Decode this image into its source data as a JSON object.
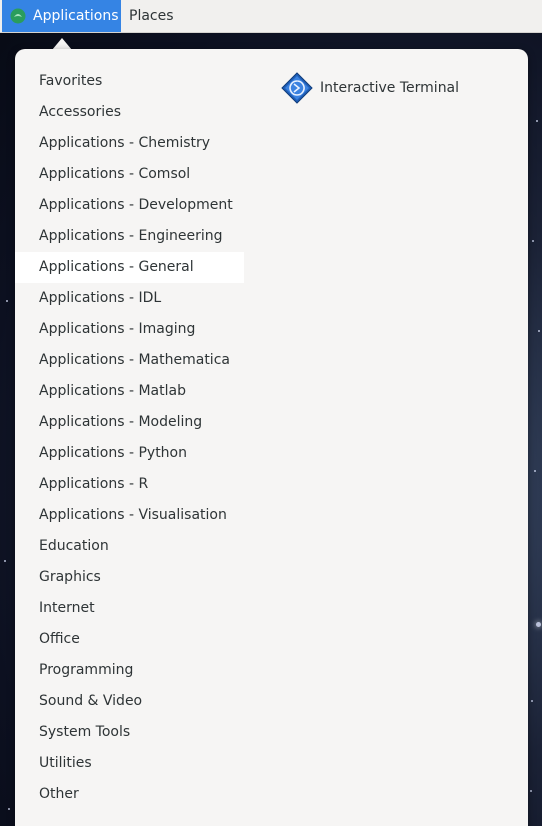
{
  "panel": {
    "applications_label": "Applications",
    "places_label": "Places"
  },
  "categories": [
    {
      "label": "Favorites"
    },
    {
      "label": "Accessories"
    },
    {
      "label": "Applications - Chemistry"
    },
    {
      "label": "Applications - Comsol"
    },
    {
      "label": "Applications - Development"
    },
    {
      "label": "Applications - Engineering"
    },
    {
      "label": "Applications - General",
      "selected": true
    },
    {
      "label": "Applications - IDL"
    },
    {
      "label": "Applications - Imaging"
    },
    {
      "label": "Applications - Mathematica"
    },
    {
      "label": "Applications - Matlab"
    },
    {
      "label": "Applications - Modeling"
    },
    {
      "label": "Applications - Python"
    },
    {
      "label": "Applications - R"
    },
    {
      "label": "Applications - Visualisation"
    },
    {
      "label": "Education"
    },
    {
      "label": "Graphics"
    },
    {
      "label": "Internet"
    },
    {
      "label": "Office"
    },
    {
      "label": "Programming"
    },
    {
      "label": "Sound & Video"
    },
    {
      "label": "System Tools"
    },
    {
      "label": "Utilities"
    },
    {
      "label": "Other"
    }
  ],
  "apps": [
    {
      "label": "Interactive Terminal",
      "icon": "terminal-diamond-icon"
    }
  ],
  "colors": {
    "panel_active": "#3584e4",
    "menu_bg": "#f6f5f4",
    "text": "#2e3436"
  }
}
